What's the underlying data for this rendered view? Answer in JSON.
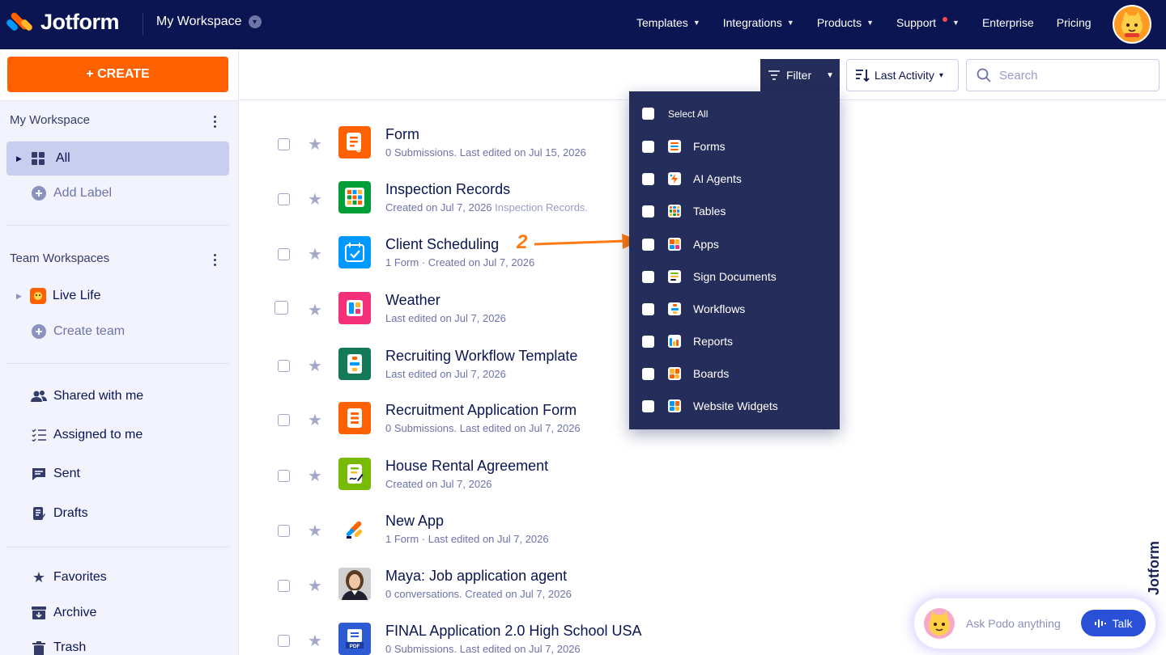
{
  "brand": {
    "name": "Jotform",
    "vertical_label": "Jotform"
  },
  "header": {
    "workspace": "My Workspace",
    "nav": [
      {
        "label": "Templates",
        "dropdown": true
      },
      {
        "label": "Integrations",
        "dropdown": true
      },
      {
        "label": "Products",
        "dropdown": true
      },
      {
        "label": "Support",
        "dropdown": true,
        "dot": true
      },
      {
        "label": "Enterprise",
        "dropdown": false
      },
      {
        "label": "Pricing",
        "dropdown": false
      }
    ]
  },
  "sidebar": {
    "create_label": "+ CREATE",
    "my_workspace_title": "My Workspace",
    "all_label": "All",
    "add_label": "Add Label",
    "team_workspaces_title": "Team Workspaces",
    "team_name": "Live Life",
    "create_team": "Create team",
    "links": [
      "Shared with me",
      "Assigned to me",
      "Sent",
      "Drafts"
    ],
    "bottom_links": [
      "Favorites",
      "Archive",
      "Trash"
    ]
  },
  "toolbar": {
    "filter_label": "Filter",
    "sort_label": "Last Activity",
    "search_placeholder": "Search"
  },
  "items": [
    {
      "title": "Form",
      "subtitle": "0 Submissions. Last edited on Jul 15, 2026",
      "icon": "form-icon",
      "color": "#ff6100"
    },
    {
      "title": "Inspection Records",
      "subtitle": "Created on Jul 7, 2026 ",
      "subtitle_extra": "Inspection Records.",
      "icon": "table-icon",
      "color": "#049e38"
    },
    {
      "title": "Client Scheduling",
      "subtitle": "1 Form · Created on Jul 7, 2026",
      "icon": "calendar-icon",
      "color": "#0099ff"
    },
    {
      "title": "Weather",
      "subtitle": "Last edited on Jul 7, 2026",
      "icon": "app-icon",
      "color": "#f4307a"
    },
    {
      "title": "Recruiting Workflow Template",
      "subtitle": " Last edited on Jul 7, 2026",
      "icon": "workflow-icon",
      "color": "#147a56"
    },
    {
      "title": "Recruitment Application Form",
      "subtitle": "0 Submissions. Last edited on Jul 7, 2026",
      "icon": "form-icon",
      "color": "#ff6100"
    },
    {
      "title": "House Rental Agreement",
      "subtitle": "Created on Jul 7, 2026",
      "icon": "sign-document-icon",
      "color": "#78bb07"
    },
    {
      "title": "New App",
      "subtitle": "1 Form · Last edited on Jul 7, 2026",
      "icon": "jotform-logo-icon",
      "color": "#ffffff"
    },
    {
      "title": "Maya: Job application agent",
      "subtitle": "0 conversations. Created on Jul 7, 2026",
      "icon": "agent-avatar-icon",
      "color": "#d8d8d8"
    },
    {
      "title": "FINAL Application 2.0 High School USA",
      "subtitle": "0 Submissions. Last edited on Jul 7, 2026",
      "icon": "pdf-icon",
      "color": "#2d5bd4"
    }
  ],
  "filter_menu": {
    "select_all": "Select All",
    "options": [
      {
        "label": "Forms",
        "icon": "forms-icon"
      },
      {
        "label": "AI Agents",
        "icon": "ai-agents-icon"
      },
      {
        "label": "Tables",
        "icon": "tables-icon"
      },
      {
        "label": "Apps",
        "icon": "apps-icon"
      },
      {
        "label": "Sign Documents",
        "icon": "sign-documents-icon"
      },
      {
        "label": "Workflows",
        "icon": "workflows-icon"
      },
      {
        "label": "Reports",
        "icon": "reports-icon"
      },
      {
        "label": "Boards",
        "icon": "boards-icon"
      },
      {
        "label": "Website Widgets",
        "icon": "website-widgets-icon"
      }
    ]
  },
  "annotation": {
    "step": "2"
  },
  "podo": {
    "placeholder": "Ask Podo anything",
    "talk_label": "Talk"
  },
  "colors": {
    "navy": "#0a1551",
    "orange": "#ff6100",
    "menu_bg": "#252d5b",
    "talk_blue": "#2a50d8"
  }
}
